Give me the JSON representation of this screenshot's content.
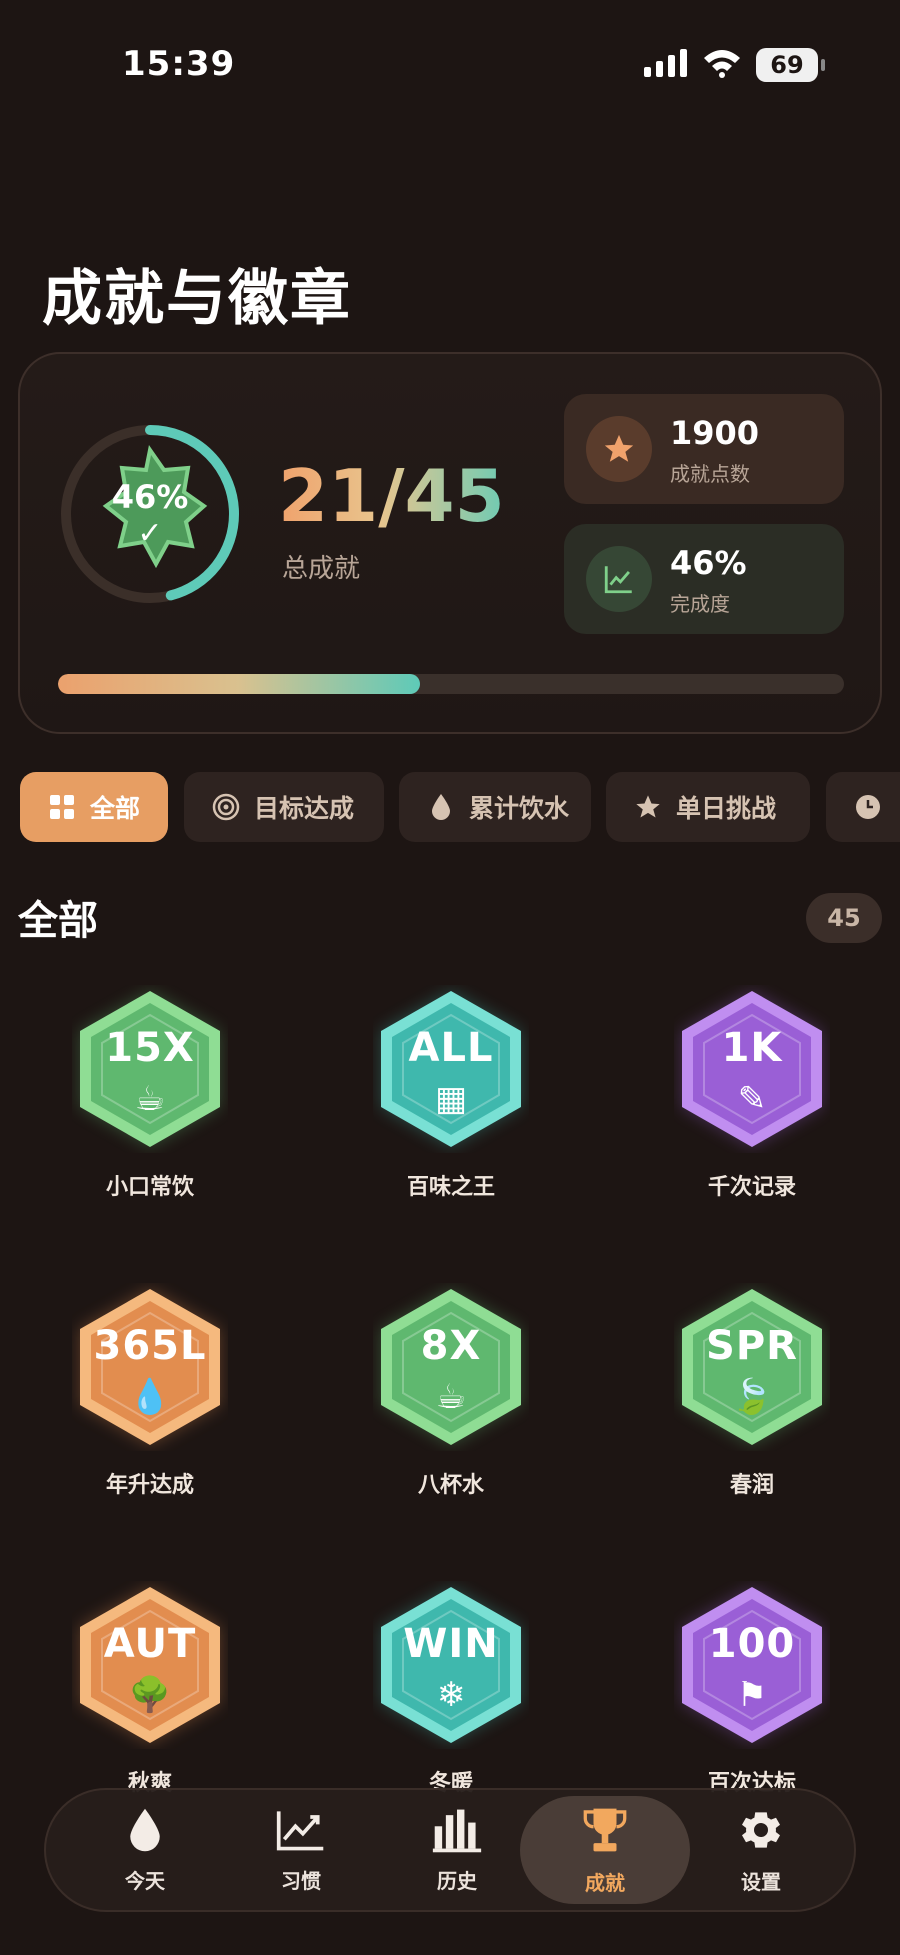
{
  "status": {
    "time": "15:39",
    "battery": "69"
  },
  "page_title": "成就与徽章",
  "summary": {
    "percent_text": "46%",
    "ring_fraction": 0.46,
    "check_glyph": "✓",
    "count": "21/45",
    "count_label": "总成就",
    "points_value": "1900",
    "points_label": "成就点数",
    "completion_value": "46%",
    "completion_label": "完成度",
    "progress_fraction": 0.46
  },
  "tabs": [
    {
      "label": "全部",
      "icon": "grid-icon"
    },
    {
      "label": "目标达成",
      "icon": "target-icon"
    },
    {
      "label": "累计饮水",
      "icon": "drop-icon"
    },
    {
      "label": "单日挑战",
      "icon": "star-icon"
    },
    {
      "label": "",
      "icon": "clock-icon"
    }
  ],
  "section": {
    "title": "全部",
    "count": "45"
  },
  "badges": [
    {
      "code": "15X",
      "glyph": "☕",
      "name": "小口常饮",
      "color": "#5fb86f",
      "light": "#8fdd94"
    },
    {
      "code": "ALL",
      "glyph": "▦",
      "name": "百味之王",
      "color": "#3fb8ad",
      "light": "#79e0d4"
    },
    {
      "code": "1K",
      "glyph": "✎",
      "name": "千次记录",
      "color": "#9a5fd6",
      "light": "#c08ef0"
    },
    {
      "code": "365L",
      "glyph": "💧",
      "name": "年升达成",
      "color": "#e28d4f",
      "light": "#f5b97e"
    },
    {
      "code": "8X",
      "glyph": "☕",
      "name": "八杯水",
      "color": "#5fb86f",
      "light": "#8fdd94"
    },
    {
      "code": "SPR",
      "glyph": "🍃",
      "name": "春润",
      "color": "#5fb86f",
      "light": "#8fdd94"
    },
    {
      "code": "AUT",
      "glyph": "🌳",
      "name": "秋爽",
      "color": "#e28d4f",
      "light": "#f5b97e"
    },
    {
      "code": "WIN",
      "glyph": "❄",
      "name": "冬暖",
      "color": "#3fb8ad",
      "light": "#79e0d4"
    },
    {
      "code": "100",
      "glyph": "⚑",
      "name": "百次达标",
      "color": "#9a5fd6",
      "light": "#c08ef0"
    }
  ],
  "nav": [
    {
      "label": "今天",
      "icon": "drop-icon"
    },
    {
      "label": "习惯",
      "icon": "trend-icon"
    },
    {
      "label": "历史",
      "icon": "bar-chart-icon"
    },
    {
      "label": "成就",
      "icon": "trophy-icon",
      "active": true
    },
    {
      "label": "设置",
      "icon": "gear-icon"
    }
  ]
}
